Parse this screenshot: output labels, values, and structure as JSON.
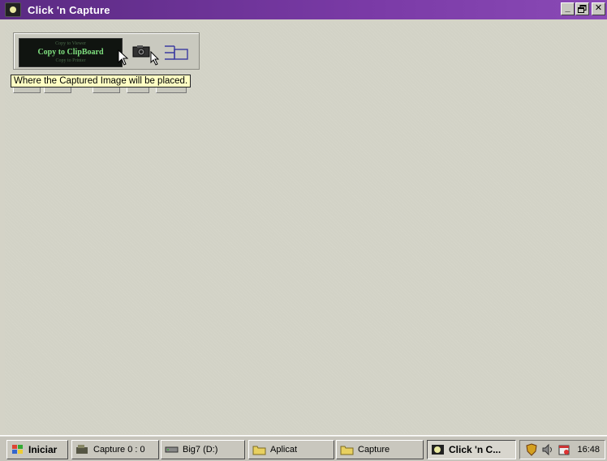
{
  "window": {
    "title": "Click 'n Capture",
    "icon": "app-icon",
    "controls": {
      "minimize": "_",
      "maximize": "🗗",
      "close": "✕"
    }
  },
  "toolbar": {
    "mode_prev": "Copy to Viewer",
    "mode_current": "Copy to ClipBoard",
    "mode_next": "Copy to Printer",
    "icons": [
      "pointer-cursor-icon",
      "camera-icon",
      "layout-icon"
    ]
  },
  "tooltip": {
    "text": "Where the Captured Image will be placed."
  },
  "taskbar": {
    "start_label": "Iniciar",
    "items": [
      {
        "label": "Capture 0 : 0",
        "icon": "capture-icon"
      },
      {
        "label": "Big7 (D:)",
        "icon": "drive-icon"
      },
      {
        "label": "Aplicat",
        "icon": "folder-icon"
      },
      {
        "label": "Capture",
        "icon": "folder-icon"
      },
      {
        "label": "Click 'n C...",
        "icon": "app-icon",
        "active": true
      }
    ],
    "clock": "16:48"
  },
  "colors": {
    "titlebar": "#6a3298",
    "desktop": "#d2d2c6",
    "tooltip_bg": "#ffffc4",
    "mode_text": "#7fe07f"
  }
}
